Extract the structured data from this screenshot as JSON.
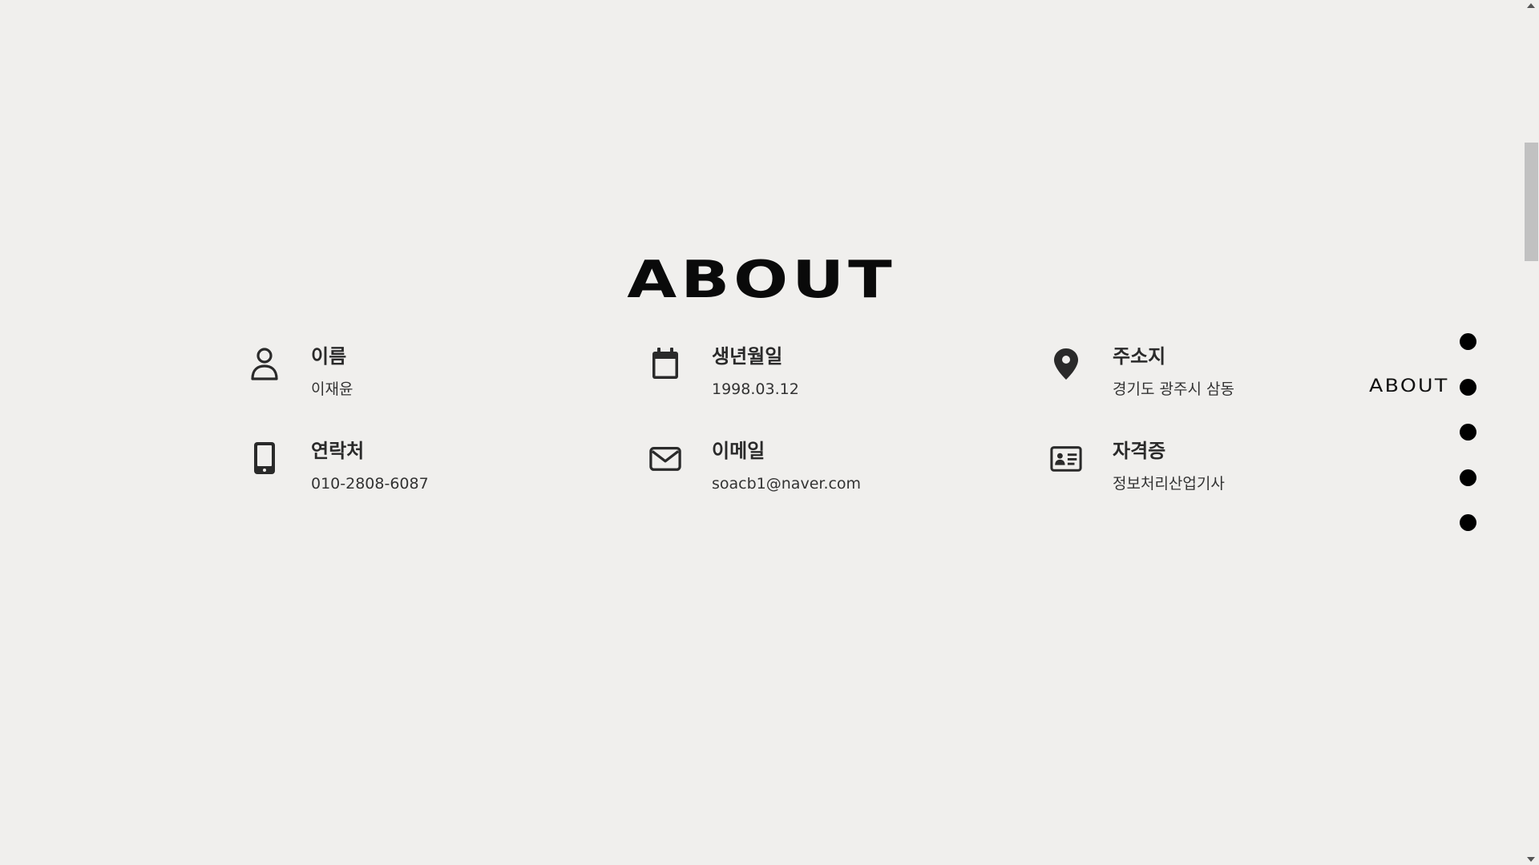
{
  "section": {
    "title": "ABOUT"
  },
  "info": {
    "items": [
      {
        "icon": "person-icon",
        "label": "이름",
        "value": "이재윤"
      },
      {
        "icon": "calendar-icon",
        "label": "생년월일",
        "value": "1998.03.12"
      },
      {
        "icon": "location-pin-icon",
        "label": "주소지",
        "value": "경기도 광주시 삼동"
      },
      {
        "icon": "mobile-phone-icon",
        "label": "연락처",
        "value": "010-2808-6087"
      },
      {
        "icon": "mail-icon",
        "label": "이메일",
        "value": "soacb1@naver.com"
      },
      {
        "icon": "id-card-icon",
        "label": "자격증",
        "value": "정보처리산업기사"
      }
    ]
  },
  "side_nav": {
    "active_label": "ABOUT",
    "dot_count": 5,
    "active_index": 1
  },
  "scrollbar": {
    "position_fraction": 0.14
  }
}
